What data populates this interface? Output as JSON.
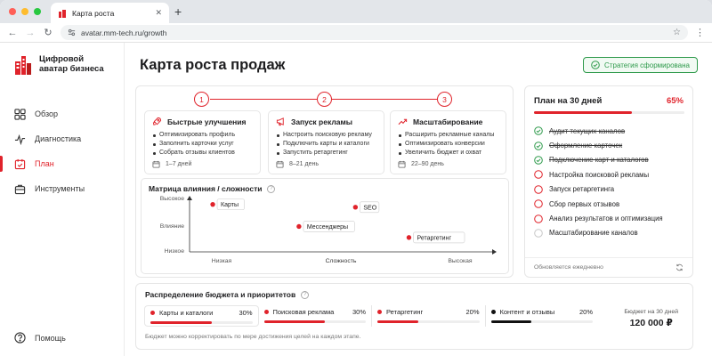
{
  "browser": {
    "tab_title": "Карта роста",
    "url": "avatar.mm-tech.ru/growth"
  },
  "brand": {
    "line1": "Цифровой",
    "line2": "аватар бизнеса"
  },
  "sidebar": {
    "items": [
      {
        "label": "Обзор",
        "icon": "grid-icon",
        "active": false
      },
      {
        "label": "Диагностика",
        "icon": "pulse-icon",
        "active": false
      },
      {
        "label": "План",
        "icon": "calendar-check-icon",
        "active": true
      },
      {
        "label": "Инструменты",
        "icon": "briefcase-icon",
        "active": false
      }
    ],
    "help_label": "Помощь"
  },
  "page": {
    "title": "Карта роста продаж",
    "status_badge": "Стратегия сформирована"
  },
  "roadmap": {
    "steps": [
      "1",
      "2",
      "3"
    ],
    "stages": [
      {
        "title": "Быстрые улучшения",
        "icon": "rocket-icon",
        "items": [
          "Оптимизировать профиль",
          "Заполнить карточки услуг",
          "Собрать отзывы клиентов"
        ],
        "duration": "1–7 дней"
      },
      {
        "title": "Запуск рекламы",
        "icon": "megaphone-icon",
        "items": [
          "Настроить поисковую рекламу",
          "Подключить карты и каталоги",
          "Запустить ретаргетинг"
        ],
        "duration": "8–21 день"
      },
      {
        "title": "Масштабирование",
        "icon": "trend-up-icon",
        "items": [
          "Расширить рекламные каналы",
          "Оптимизировать конверсии",
          "Увеличить бюджет и охват"
        ],
        "duration": "22–90 день"
      }
    ]
  },
  "chart_data": {
    "type": "scatter",
    "title": "Матрица влияния / сложности",
    "xlabel": "Сложность",
    "ylabel": "",
    "x_ticks": [
      "Низкая",
      "Высокая"
    ],
    "y_ticks": [
      "Высокое",
      "Влияние",
      "Низкое"
    ],
    "xlim": [
      0,
      10
    ],
    "ylim": [
      0,
      10
    ],
    "points": [
      {
        "label": "Карты",
        "x": 0.6,
        "y": 8.6
      },
      {
        "label": "SEO",
        "x": 5.4,
        "y": 8.1
      },
      {
        "label": "Мессенджеры",
        "x": 3.5,
        "y": 4.6
      },
      {
        "label": "Ретаргетинг",
        "x": 7.2,
        "y": 2.6
      }
    ],
    "accent": "#e0232b"
  },
  "plan": {
    "title": "План на 30 дней",
    "percent": "65%",
    "progress": 0.65,
    "items": [
      {
        "label": "Аудит текущих каналов",
        "state": "done"
      },
      {
        "label": "Оформление карточек",
        "state": "done"
      },
      {
        "label": "Подключение карт и каталогов",
        "state": "done"
      },
      {
        "label": "Настройка поисковой рекламы",
        "state": "todo"
      },
      {
        "label": "Запуск ретаргетинга",
        "state": "todo"
      },
      {
        "label": "Сбор первых отзывов",
        "state": "todo"
      },
      {
        "label": "Анализ результатов и оптимизация",
        "state": "todo"
      },
      {
        "label": "Масштабирование каналов",
        "state": "later"
      }
    ],
    "footer": "Обновляется ежедневно"
  },
  "budget": {
    "title": "Распределение бюджета и приоритетов",
    "items": [
      {
        "label": "Карты и каталоги",
        "percent": "30%",
        "value": 0.3,
        "color": "#e0232b"
      },
      {
        "label": "Поисковая реклама",
        "percent": "30%",
        "value": 0.3,
        "color": "#e0232b"
      },
      {
        "label": "Ретаргетинг",
        "percent": "20%",
        "value": 0.2,
        "color": "#e0232b"
      },
      {
        "label": "Контент и отзывы",
        "percent": "20%",
        "value": 0.2,
        "color": "#111111"
      }
    ],
    "total_label": "Бюджет на 30 дней",
    "total_value": "120 000 ₽",
    "note": "Бюджет можно корректировать по мере достижения целей на каждом этапе."
  },
  "colors": {
    "accent": "#e0232b",
    "success": "#2e9a4b"
  }
}
